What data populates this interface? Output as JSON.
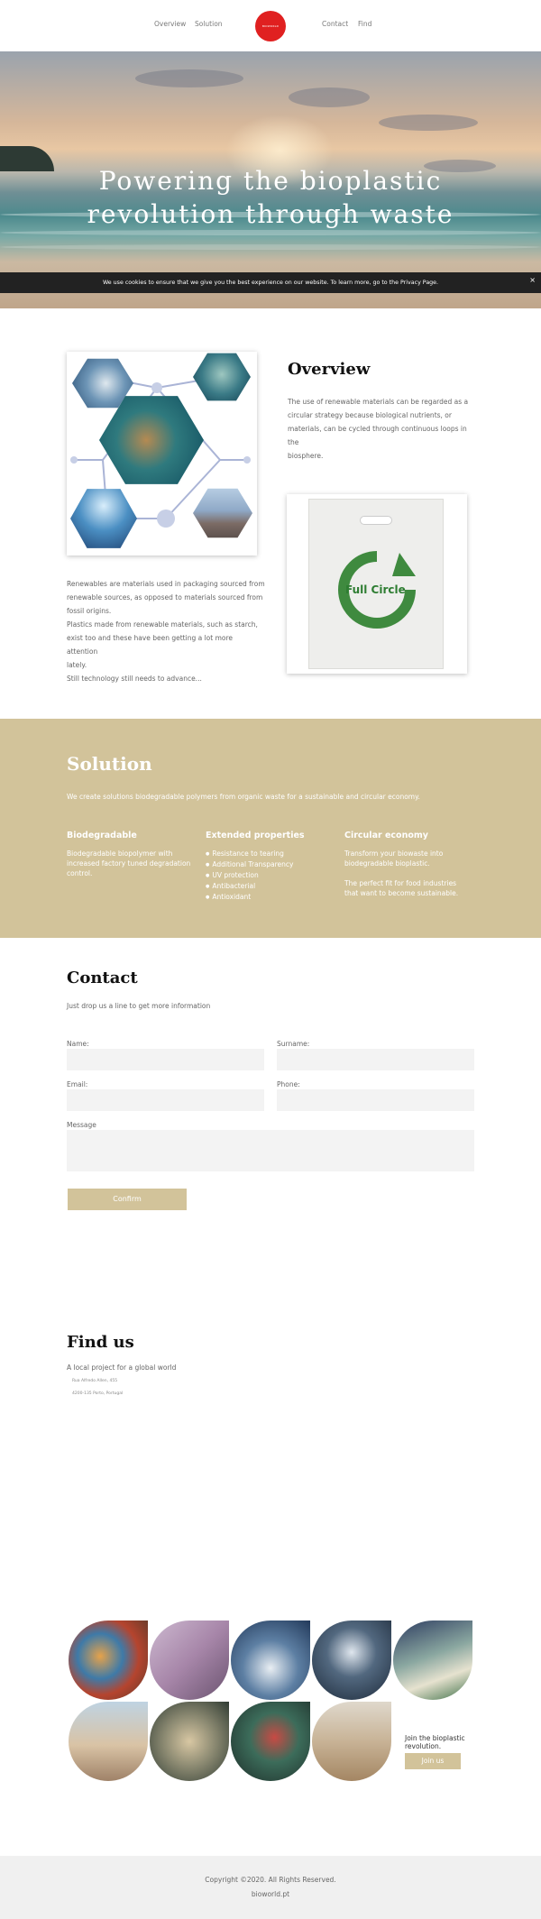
{
  "nav": {
    "left": [
      "Overview",
      "Solution"
    ],
    "right": [
      "Contact",
      "Find"
    ],
    "logo_text": "BIOWORLD"
  },
  "hero": {
    "title_line1": "Powering the bioplastic",
    "title_line2": "revolution through waste"
  },
  "cookie": {
    "text": "We use cookies to ensure that we give you the best experience on our website. To learn more, go to the Privacy Page.",
    "close": "×"
  },
  "overview": {
    "title": "Overview",
    "text_lines": [
      "The use of renewable materials can be regarded as a",
      "circular strategy because biological nutrients, or",
      "materials, can be cycled through continuous loops in the",
      "biosphere."
    ],
    "left_lines": [
      "Renewables are materials used in packaging sourced from",
      "renewable sources, as opposed to materials sourced from",
      "fossil origins.",
      "Plastics made from renewable materials, such as starch,",
      "exist too and these have been getting a lot more attention",
      "lately.",
      "Still technology still needs to advance..."
    ],
    "bag_text": "Full Circle"
  },
  "solution": {
    "title": "Solution",
    "intro": "We create solutions biodegradable polymers from organic waste for a sustainable and circular economy.",
    "col1_title": "Biodegradable",
    "col1_lines": [
      "Biodegradable biopolymer with",
      "increased factory tuned degradation",
      "control."
    ],
    "col2_title": "Extended properties",
    "col2_items": [
      "Resistance to tearing",
      "Additional Transparency",
      "UV protection",
      "Antibacterial",
      "Antioxidant"
    ],
    "col3_title": "Circular economy",
    "col3_lines": [
      "Transform your biowaste into",
      "biodegradable bioplastic."
    ],
    "col3_lines2": [
      "The perfect fit for food industries",
      "that want to become sustainable."
    ]
  },
  "contact": {
    "title": "Contact",
    "subtitle": "Just drop us a line to get more information",
    "name_label": "Name:",
    "surname_label": "Surname:",
    "email_label": "Email:",
    "phone_label": "Phone:",
    "message_label": "Message",
    "confirm": "Confirm"
  },
  "find": {
    "title": "Find us",
    "subtitle": "A local project for a global world",
    "address1": "Rua Alfredo Allen, 455",
    "address2": "4200-135 Porto, Portugal"
  },
  "gallery": {
    "join_line1": "Join the bioplastic",
    "join_line2": "revolution.",
    "join_button": "Join us"
  },
  "footer": {
    "copyright": "Copyright ©2020. All Rights Reserved.",
    "site": "bioworld.pt"
  },
  "colors": {
    "accent": "#d2c39a",
    "logo": "#e02020",
    "footer_bg": "#f0f0f0"
  }
}
